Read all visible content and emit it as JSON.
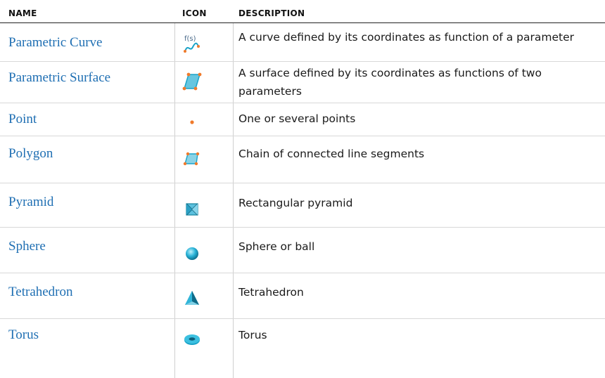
{
  "header": {
    "name": "NAME",
    "icon": "ICON",
    "description": "DESCRIPTION"
  },
  "rows": [
    {
      "name": "Parametric Curve",
      "icon": "parametric-curve-icon",
      "description": "A curve defined by its coordinates as function of a parameter",
      "icon_text": "f(s)"
    },
    {
      "name": "Parametric Surface",
      "icon": "parametric-surface-icon",
      "description": "A surface defined by its coordinates as functions of two parameters"
    },
    {
      "name": "Point",
      "icon": "point-icon",
      "description": "One or several points"
    },
    {
      "name": "Polygon",
      "icon": "polygon-icon",
      "description": "Chain of connected line segments"
    },
    {
      "name": "Pyramid",
      "icon": "pyramid-icon",
      "description": "Rectangular pyramid"
    },
    {
      "name": "Sphere",
      "icon": "sphere-icon",
      "description": "Sphere or ball"
    },
    {
      "name": "Tetrahedron",
      "icon": "tetrahedron-icon",
      "description": "Tetrahedron"
    },
    {
      "name": "Torus",
      "icon": "torus-icon",
      "description": "Torus"
    }
  ],
  "colors": {
    "link": "#1f6fb3",
    "accent_orange": "#f07a2b",
    "icon_teal": "#1aa3c8"
  }
}
